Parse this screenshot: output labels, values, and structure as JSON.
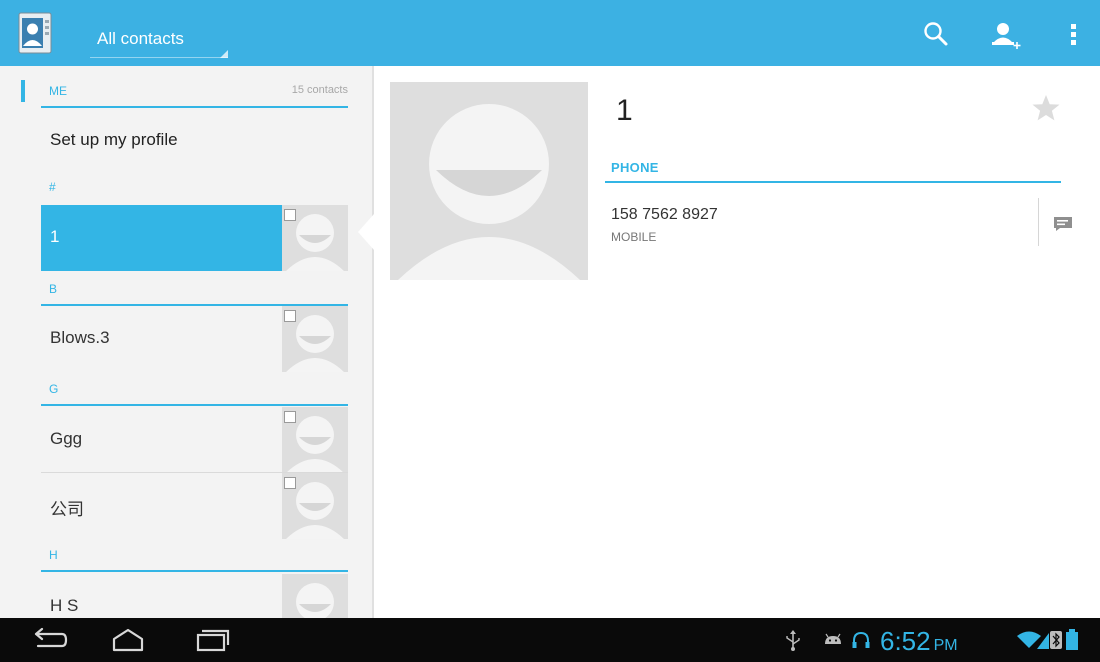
{
  "actionbar": {
    "account_label": "All contacts",
    "icons": [
      "contacts-app-icon",
      "search-icon",
      "add-contact-icon",
      "overflow-menu-icon"
    ]
  },
  "contact_list": {
    "me_header": "ME",
    "contact_count": "15 contacts",
    "setup_profile": "Set up my profile",
    "sections": [
      {
        "letter": "#",
        "contacts": [
          {
            "name": "1",
            "selected": true
          }
        ]
      },
      {
        "letter": "B",
        "contacts": [
          {
            "name": "Blows.3",
            "selected": false
          }
        ]
      },
      {
        "letter": "G",
        "contacts": [
          {
            "name": "Ggg",
            "selected": false
          },
          {
            "name": "公司",
            "selected": false
          }
        ]
      },
      {
        "letter": "H",
        "contacts": [
          {
            "name": "H S",
            "selected": false
          }
        ]
      }
    ]
  },
  "detail": {
    "name": "1",
    "phone_header": "PHONE",
    "phone_number": "158 7562 8927",
    "phone_type": "MOBILE",
    "icons": [
      "star-icon",
      "message-icon"
    ]
  },
  "systembar": {
    "time": "6:52",
    "ampm": "PM",
    "icons": [
      "back-icon",
      "home-icon",
      "recent-apps-icon",
      "usb-icon",
      "android-debug-icon",
      "headset-icon",
      "wifi-icon",
      "signal-icon",
      "bluetooth-icon",
      "battery-icon"
    ]
  },
  "colors": {
    "accent": "#33b5e5",
    "actionbar": "#3cb1e3",
    "list_background": "#f3f3f3",
    "navbar": "#0a0a0a"
  }
}
